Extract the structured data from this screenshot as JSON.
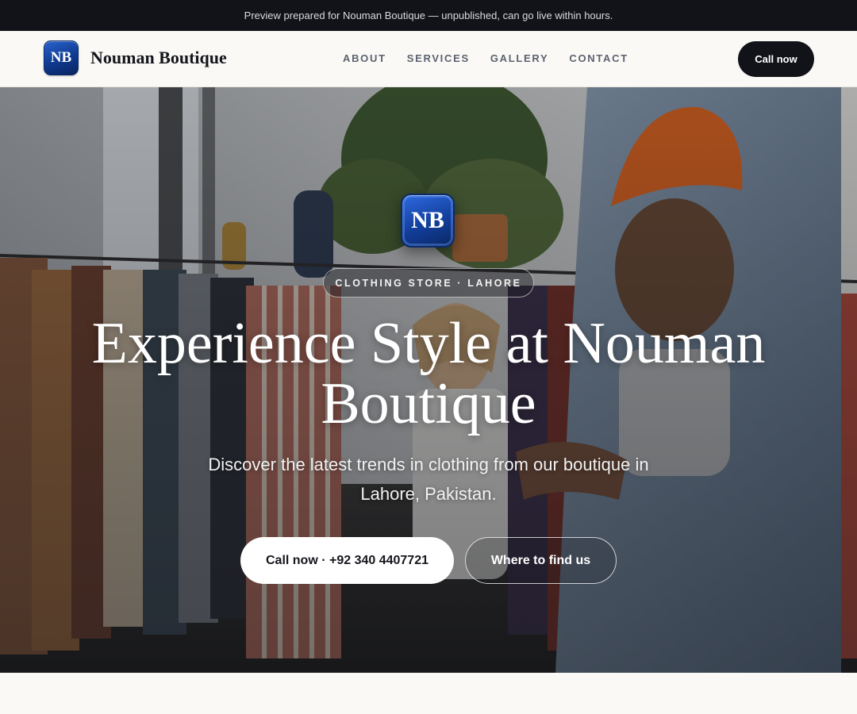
{
  "preview_banner": "Preview prepared for Nouman Boutique — unpublished, can go live within hours.",
  "header": {
    "logo_text": "NB",
    "brand_name": "Nouman Boutique",
    "nav": [
      "ABOUT",
      "SERVICES",
      "GALLERY",
      "CONTACT"
    ],
    "cta_label": "Call now"
  },
  "hero": {
    "logo_text": "NB",
    "badge": "CLOTHING STORE · LAHORE",
    "title": "Experience Style at Nouman Boutique",
    "subtitle": "Discover the latest trends in clothing from our boutique in Lahore, Pakistan.",
    "primary_button": "Call now · +92 340 4407721",
    "secondary_button": "Where to find us"
  },
  "colors": {
    "top_bar": "#111318",
    "header_bg": "#faf9f6",
    "dark_button": "#121318",
    "logo_blue": "#123f9c"
  }
}
